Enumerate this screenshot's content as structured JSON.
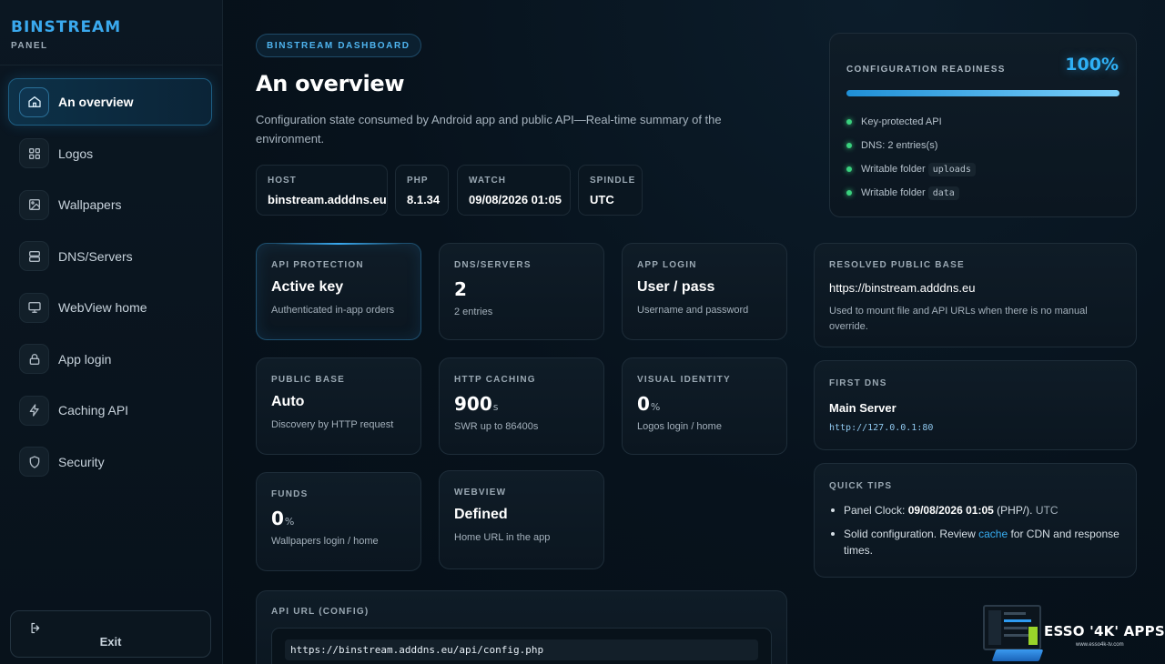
{
  "brand": {
    "title": "BINSTREAM",
    "subtitle": "PANEL"
  },
  "sidebar": {
    "items": [
      {
        "label": "An overview",
        "icon": "home-icon",
        "active": true
      },
      {
        "label": "Logos",
        "icon": "grid-icon"
      },
      {
        "label": "Wallpapers",
        "icon": "image-icon"
      },
      {
        "label": "DNS/Servers",
        "icon": "server-icon"
      },
      {
        "label": "WebView home",
        "icon": "monitor-icon"
      },
      {
        "label": "App login",
        "icon": "lock-icon"
      },
      {
        "label": "Caching API",
        "icon": "bolt-icon"
      },
      {
        "label": "Security",
        "icon": "shield-icon"
      }
    ],
    "exit_label": "Exit"
  },
  "header": {
    "pill": "BINSTREAM DASHBOARD",
    "title": "An overview",
    "description": "Configuration state consumed by Android app and public API—Real-time summary of the environment."
  },
  "env": {
    "host": {
      "label": "HOST",
      "value": "binstream.adddns.eu"
    },
    "php": {
      "label": "PHP",
      "value": "8.1.34"
    },
    "watch": {
      "label": "WATCH",
      "value": "09/08/2026 01:05"
    },
    "spindle": {
      "label": "SPINDLE",
      "value": "UTC"
    }
  },
  "readiness": {
    "label": "CONFIGURATION READINESS",
    "percent_text": "100%",
    "percent": 100,
    "items": {
      "api": "Key-protected API",
      "dns": "DNS: 2 entries(s)",
      "uploads_text": "Writable folder",
      "uploads_code": "uploads",
      "data_text": "Writable folder",
      "data_code": "data"
    }
  },
  "stats": {
    "api_protection": {
      "label": "API PROTECTION",
      "value": "Active key",
      "sub": "Authenticated in-app orders"
    },
    "dns_servers": {
      "label": "DNS/SERVERS",
      "value": "2",
      "sub": "2 entries"
    },
    "app_login": {
      "label": "APP LOGIN",
      "value": "User / pass",
      "sub": "Username and password"
    },
    "public_base": {
      "label": "PUBLIC BASE",
      "value": "Auto",
      "sub": "Discovery by HTTP request"
    },
    "http_caching": {
      "label": "HTTP CACHING",
      "value": "900",
      "unit": "s",
      "sub": "SWR up to 86400s"
    },
    "visual_identity": {
      "label": "VISUAL IDENTITY",
      "value": "0",
      "unit": "%",
      "sub": "Logos login / home"
    },
    "funds": {
      "label": "FUNDS",
      "value": "0",
      "unit": "%",
      "sub": "Wallpapers login / home"
    },
    "webview": {
      "label": "WEBVIEW",
      "value": "Defined",
      "sub": "Home URL in the app"
    }
  },
  "resolved": {
    "label": "RESOLVED PUBLIC BASE",
    "url": "https://binstream.adddns.eu",
    "note": "Used to mount file and API URLs when there is no manual override."
  },
  "first_dns": {
    "label": "FIRST DNS",
    "name": "Main Server",
    "address": "http://127.0.0.1:80"
  },
  "tips": {
    "label": "QUICK TIPS",
    "tip1_prefix": "Panel Clock:",
    "tip1_time": "09/08/2026 01:05",
    "tip1_php": "(PHP/).",
    "tip1_tz": "UTC",
    "tip2_prefix": "Solid configuration. Review",
    "tip2_link": "cache",
    "tip2_suffix": "for CDN and response times."
  },
  "api_url": {
    "label": "API URL (CONFIG)",
    "value": "https://binstream.adddns.eu/api/config.php"
  },
  "watermark": {
    "text": "ESSO '4K' APPS",
    "url": "www.esso4k-tv.com"
  },
  "colors": {
    "accent": "#3aa9ee",
    "success": "#3ad17e",
    "background": "#07121c"
  }
}
